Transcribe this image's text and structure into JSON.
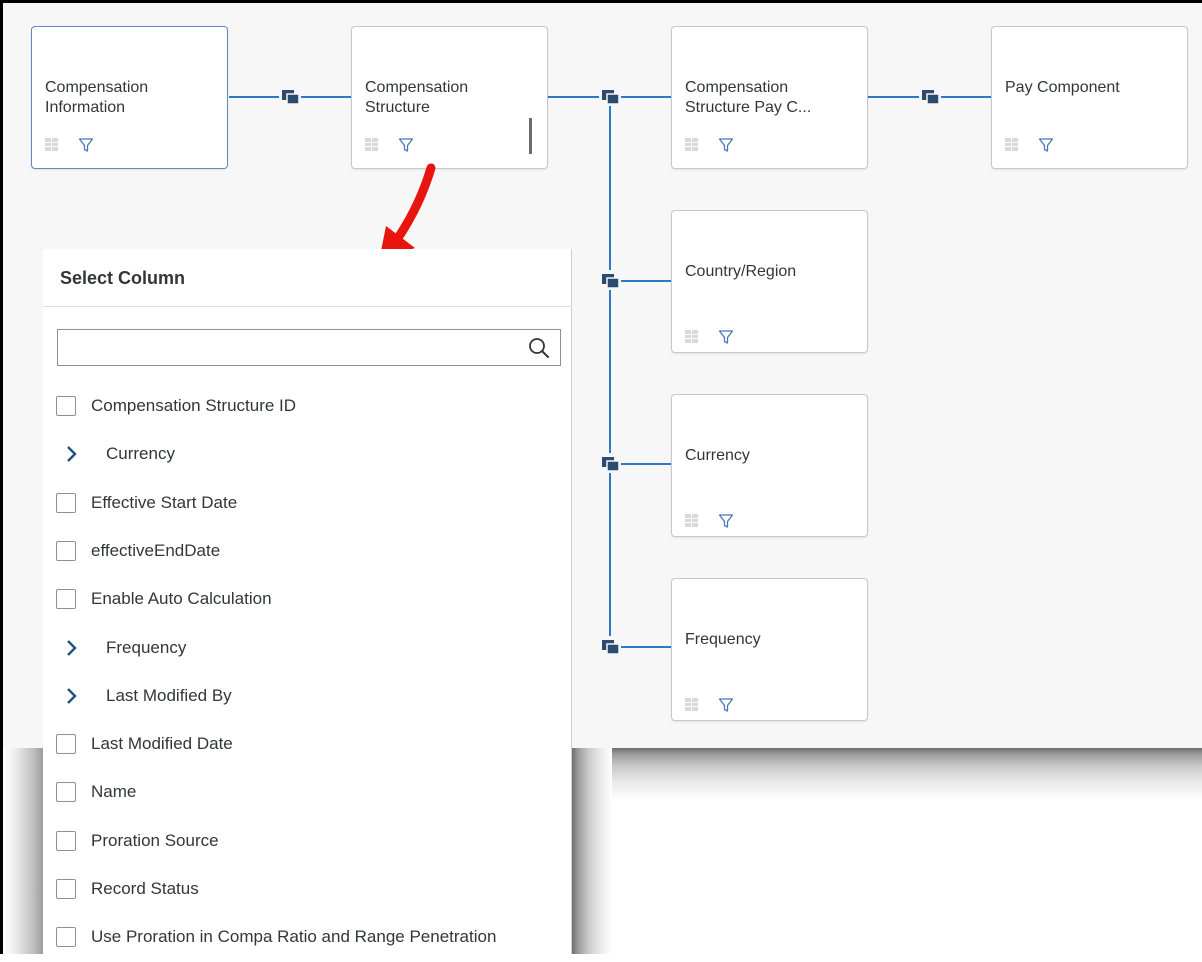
{
  "nodes": {
    "compensation_information": "Compensation Information",
    "compensation_structure": "Compensation Structure",
    "compensation_structure_pay": "Compensation Structure Pay C...",
    "pay_component": "Pay Component",
    "country_region": "Country/Region",
    "currency": "Currency",
    "frequency": "Frequency"
  },
  "panel": {
    "title": "Select Column",
    "search": {
      "placeholder": "",
      "value": ""
    },
    "items": [
      {
        "label": "Compensation Structure ID",
        "type": "checkbox",
        "checked": false
      },
      {
        "label": "Currency",
        "type": "expandable"
      },
      {
        "label": "Effective Start Date",
        "type": "checkbox",
        "checked": false
      },
      {
        "label": "effectiveEndDate",
        "type": "checkbox",
        "checked": false
      },
      {
        "label": "Enable Auto Calculation",
        "type": "checkbox",
        "checked": false
      },
      {
        "label": "Frequency",
        "type": "expandable"
      },
      {
        "label": "Last Modified By",
        "type": "expandable"
      },
      {
        "label": "Last Modified Date",
        "type": "checkbox",
        "checked": false
      },
      {
        "label": "Name",
        "type": "checkbox",
        "checked": false
      },
      {
        "label": "Proration Source",
        "type": "checkbox",
        "checked": false
      },
      {
        "label": "Record Status",
        "type": "checkbox",
        "checked": false
      },
      {
        "label": "Use Proration in Compa Ratio and Range Penetration",
        "type": "checkbox",
        "checked": false
      }
    ]
  },
  "icons": {
    "table": "table-icon",
    "filter": "filter-icon",
    "join": "join-icon",
    "search": "search-icon",
    "expand": "chevron-right-icon",
    "annotation": "red-arrow-icon"
  },
  "colors": {
    "connector": "#2e78c7",
    "join_icon": "#2b4b70",
    "selected_border": "#5d8ac2",
    "arrow": "#e8150e"
  }
}
